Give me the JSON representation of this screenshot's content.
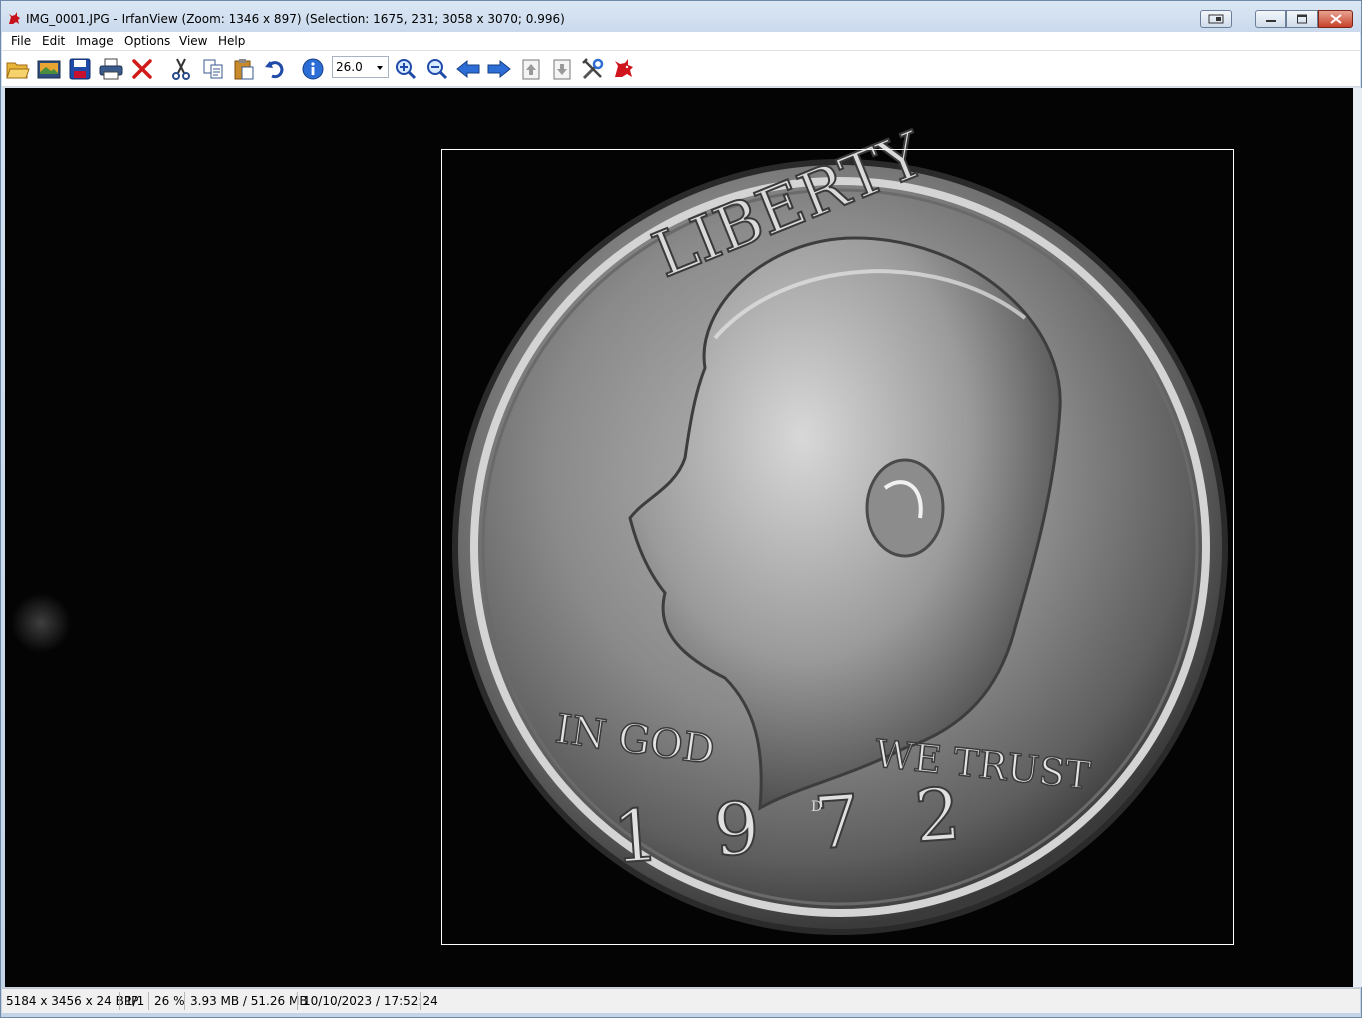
{
  "window": {
    "title": "IMG_0001.JPG - IrfanView (Zoom: 1346 x 897) (Selection: 1675, 231; 3058 x 3070; 0.996)"
  },
  "menu": {
    "items": [
      "File",
      "Edit",
      "Image",
      "Options",
      "View",
      "Help"
    ]
  },
  "toolbar": {
    "zoom_value": "26.0",
    "icons": [
      "open-folder-icon",
      "thumbnails-icon",
      "save-icon",
      "print-icon",
      "delete-icon",
      "cut-icon",
      "copy-icon",
      "paste-icon",
      "undo-icon",
      "info-icon",
      "zoom-in-icon",
      "zoom-out-icon",
      "previous-icon",
      "next-icon",
      "page-first-icon",
      "page-last-icon",
      "settings-icon",
      "irfanview-cat-icon"
    ]
  },
  "image": {
    "coin_text_top": "LIBERTY",
    "coin_text_left": "IN GOD",
    "coin_text_right": "WE TRUST",
    "coin_year": "1972",
    "mint_mark": "D"
  },
  "status": {
    "dimensions": "5184 x 3456 x 24 BPP",
    "page": "1/1",
    "zoom": "26 %",
    "memory": "3.93 MB / 51.26 MB",
    "datetime": "10/10/2023 / 17:52:24"
  },
  "colors": {
    "title_bar": "#c9d9ec",
    "viewer_bg": "#040404",
    "close_button": "#c7412b",
    "selection_border": "#ffffff"
  }
}
